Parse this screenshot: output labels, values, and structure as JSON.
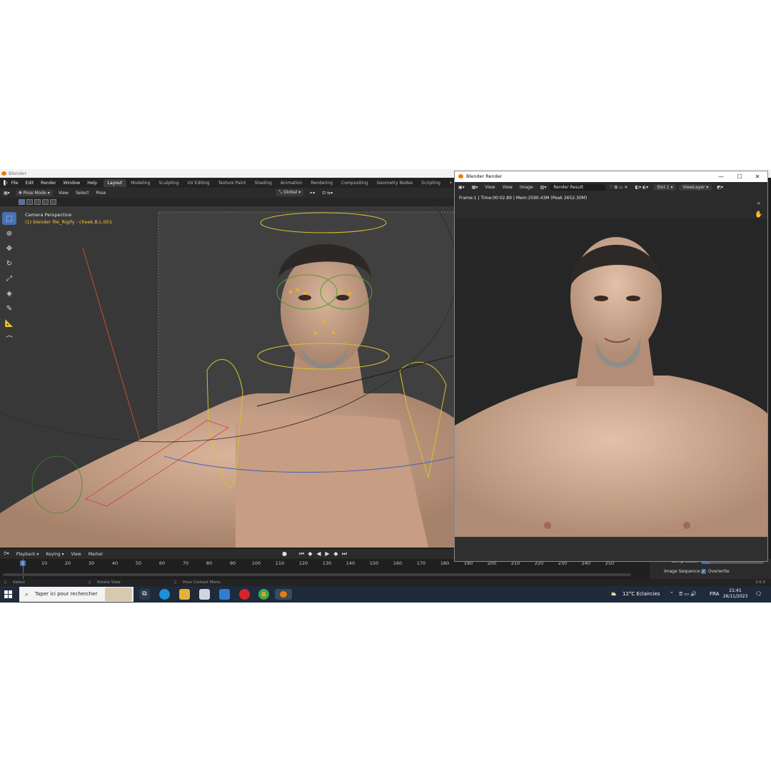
{
  "app_title": "Blender",
  "menu": {
    "items": [
      "File",
      "Edit",
      "Render",
      "Window",
      "Help"
    ],
    "workspaces": [
      "Layout",
      "Modeling",
      "Sculpting",
      "UV Editing",
      "Texture Paint",
      "Shading",
      "Animation",
      "Rendering",
      "Compositing",
      "Geometry Nodes",
      "Scripting"
    ],
    "active_workspace": "Layout",
    "add_tab": "+"
  },
  "viewport_header": {
    "mode": "Pose Mode",
    "view": "View",
    "select": "Select",
    "pose": "Pose",
    "orientation": "Global"
  },
  "viewport": {
    "camera_label": "Camera Perspective",
    "object_label": "(1) blender file_Rigify : cheek.B.L.001"
  },
  "timeline_header": {
    "playback": "Playback",
    "keying": "Keying",
    "view": "View",
    "marker": "Marker"
  },
  "timeline": {
    "current_frame": "1",
    "frame_labels": [
      "10",
      "20",
      "30",
      "40",
      "50",
      "60",
      "70",
      "80",
      "90",
      "100",
      "110",
      "120",
      "130",
      "140",
      "150",
      "160",
      "170",
      "180",
      "190",
      "200",
      "210",
      "220",
      "230",
      "240",
      "250"
    ]
  },
  "properties_panel": {
    "compression_label": "Compression",
    "compression_value": "15%",
    "image_sequence_label": "Image Sequence",
    "overwrite_label": "Overwrite"
  },
  "statusbar": {
    "select": "Select",
    "rotate": "Rotate View",
    "context": "Pose Context Menu",
    "version": "3.6.5"
  },
  "render_window": {
    "title": "Blender Render",
    "view": "View",
    "view2": "View",
    "image": "Image",
    "image_name": "Render Result",
    "slot": "Slot 1",
    "view_layer": "ViewLayer",
    "info": "Frame:1 | Time:00:02.89 | Mem:2590.43M (Peak 2652.30M)"
  },
  "taskbar": {
    "search_placeholder": "Taper ici pour rechercher",
    "weather": "12°C  Eclaircies",
    "language": "FRA",
    "time": "21:41",
    "date": "26/11/2023"
  },
  "colors": {
    "accent": "#4772b3",
    "bone_yellow": "#ffc83c",
    "blender_orange": "#e87d0d"
  }
}
